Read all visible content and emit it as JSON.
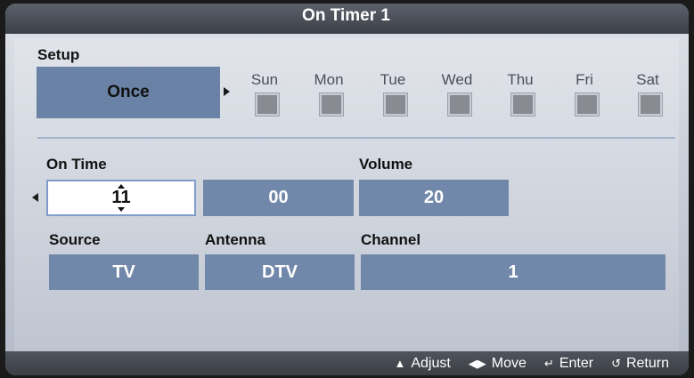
{
  "title": "On Timer 1",
  "setup": {
    "label": "Setup",
    "mode": "Once",
    "days": [
      "Sun",
      "Mon",
      "Tue",
      "Wed",
      "Thu",
      "Fri",
      "Sat"
    ]
  },
  "on_time": {
    "label": "On Time",
    "hour": "11",
    "minute": "00"
  },
  "volume": {
    "label": "Volume",
    "value": "20"
  },
  "source": {
    "label": "Source",
    "value": "TV"
  },
  "antenna": {
    "label": "Antenna",
    "value": "DTV"
  },
  "channel": {
    "label": "Channel",
    "value": "1"
  },
  "footer": {
    "adjust": "Adjust",
    "move": "Move",
    "enter": "Enter",
    "return": "Return"
  }
}
